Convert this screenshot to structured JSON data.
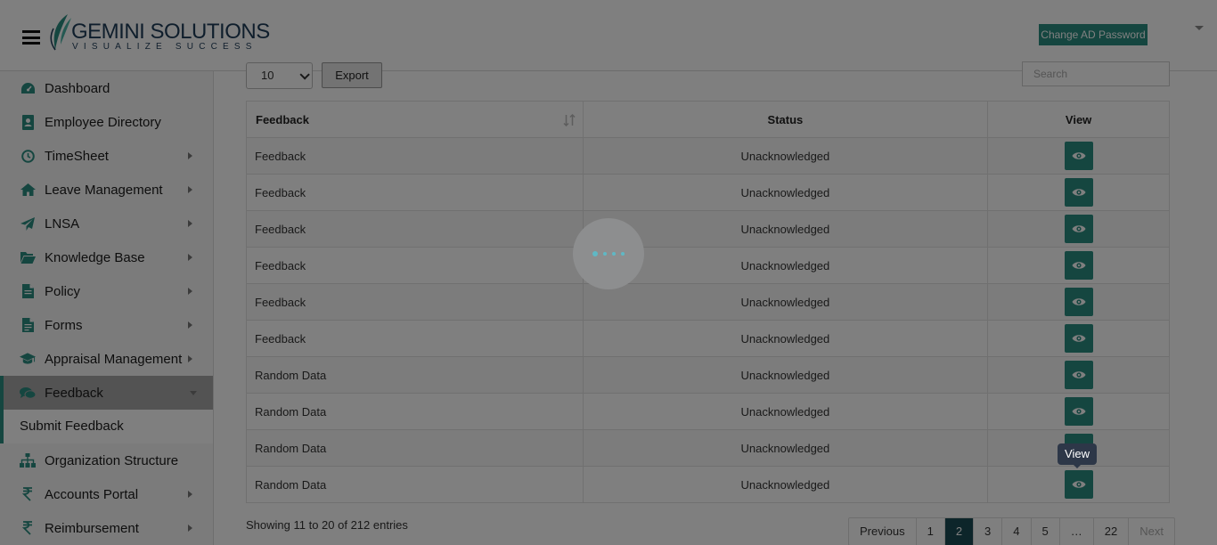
{
  "header": {
    "logo_text": "GEMINI SOLUTIONS",
    "logo_tagline": "VISUALIZE SUCCESS",
    "change_password_label": "Change AD Password"
  },
  "sidebar": {
    "items": [
      {
        "label": "Dashboard",
        "icon": "dashboard-icon",
        "has_arrow": false
      },
      {
        "label": "Employee Directory",
        "icon": "address-book-icon",
        "has_arrow": false
      },
      {
        "label": "TimeSheet",
        "icon": "clock-icon",
        "has_arrow": true
      },
      {
        "label": "Leave Management",
        "icon": "home-icon",
        "has_arrow": true
      },
      {
        "label": "LNSA",
        "icon": "paper-plane-icon",
        "has_arrow": true
      },
      {
        "label": "Knowledge Base",
        "icon": "folder-open-icon",
        "has_arrow": true
      },
      {
        "label": "Policy",
        "icon": "file-icon",
        "has_arrow": true
      },
      {
        "label": "Forms",
        "icon": "file-text-icon",
        "has_arrow": true
      },
      {
        "label": "Appraisal Management",
        "icon": "graduation-cap-icon",
        "has_arrow": true
      },
      {
        "label": "Feedback",
        "icon": "comments-icon",
        "has_arrow": true,
        "active": true
      },
      {
        "label": "Organization Structure",
        "icon": "sitemap-icon",
        "has_arrow": false
      },
      {
        "label": "Accounts Portal",
        "icon": "rupee-icon",
        "has_arrow": true
      },
      {
        "label": "Reimbursement",
        "icon": "rupee-icon",
        "has_arrow": true
      }
    ],
    "sub_item_label": "Submit Feedback"
  },
  "controls": {
    "page_length": "10",
    "export_label": "Export",
    "search_placeholder": "Search"
  },
  "table": {
    "headers": [
      "Feedback",
      "Status",
      "View"
    ],
    "rows": [
      {
        "feedback": "Feedback",
        "status": "Unacknowledged"
      },
      {
        "feedback": "Feedback",
        "status": "Unacknowledged"
      },
      {
        "feedback": "Feedback",
        "status": "Unacknowledged"
      },
      {
        "feedback": "Feedback",
        "status": "Unacknowledged"
      },
      {
        "feedback": "Feedback",
        "status": "Unacknowledged"
      },
      {
        "feedback": "Feedback",
        "status": "Unacknowledged"
      },
      {
        "feedback": "Random Data",
        "status": "Unacknowledged"
      },
      {
        "feedback": "Random Data",
        "status": "Unacknowledged"
      },
      {
        "feedback": "Random Data",
        "status": "Unacknowledged"
      },
      {
        "feedback": "Random Data",
        "status": "Unacknowledged"
      }
    ],
    "view_icon": "eye-icon"
  },
  "tooltip_text": "View",
  "info_text": "Showing 11 to 20 of 212 entries",
  "pagination": {
    "pages": [
      "Previous",
      "1",
      "2",
      "3",
      "4",
      "5",
      "…",
      "22",
      "Next"
    ],
    "active": "2"
  },
  "colors": {
    "accent": "#2b8c80",
    "active_page": "#1a4a55",
    "brand_text": "#1e3c59"
  }
}
